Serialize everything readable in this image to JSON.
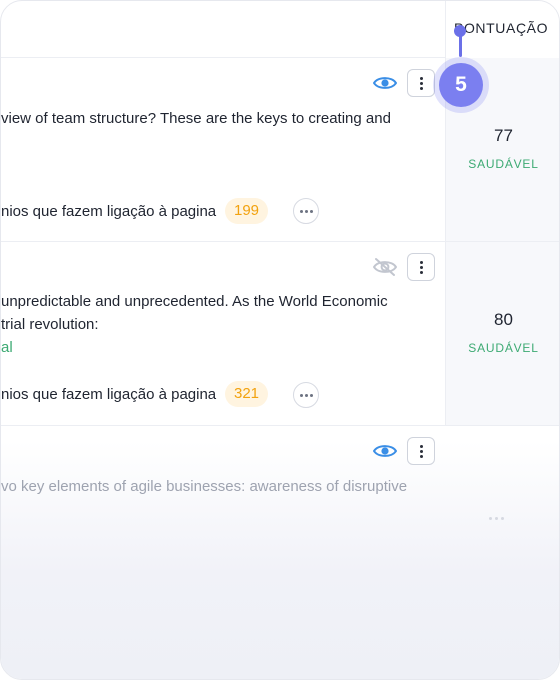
{
  "header": {
    "score_column": "PONTUAÇÃO"
  },
  "step_marker": {
    "number": "5"
  },
  "rows": [
    {
      "description": [
        "view of team structure? These are the keys to creating and"
      ],
      "links_label": "nios que fazem ligação à pagina",
      "links_count": "199",
      "score": "77",
      "status": "SAUDÁVEL",
      "visibility": "visible"
    },
    {
      "description": [
        "unpredictable and unprecedented. As the World Economic",
        "trial revolution:"
      ],
      "link_text": "al",
      "links_label": "nios que fazem ligação à pagina",
      "links_count": "321",
      "score": "80",
      "status": "SAUDÁVEL",
      "visibility": "hidden"
    },
    {
      "description": [
        "vo key elements of agile businesses: awareness of disruptive"
      ],
      "visibility": "visible"
    }
  ],
  "colors": {
    "accent": "#7b7ff0",
    "healthy": "#3daa73",
    "count_badge_text": "#f2a20f",
    "eye_icon": "#3a8ee6"
  },
  "icons": [
    "eye-icon",
    "eye-off-icon",
    "kebab-menu-icon",
    "more-horizontal-icon"
  ]
}
